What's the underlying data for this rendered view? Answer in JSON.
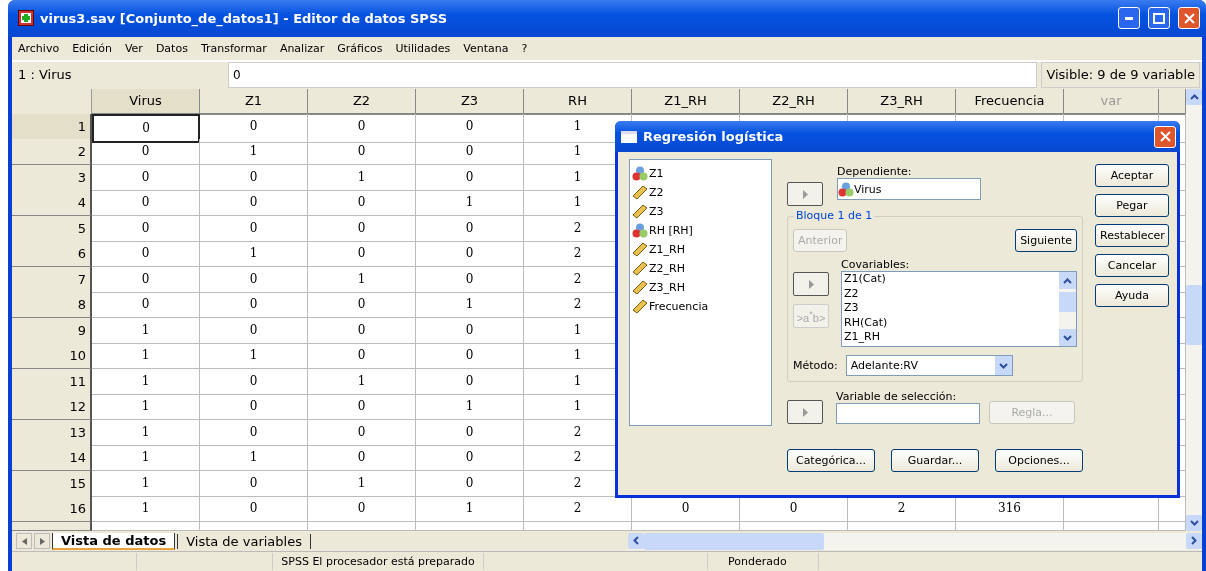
{
  "window": {
    "title": "virus3.sav [Conjunto_de_datos1] - Editor de datos SPSS"
  },
  "menu": [
    "Archivo",
    "Edición",
    "Ver",
    "Datos",
    "Transformar",
    "Analizar",
    "Gráficos",
    "Utilidades",
    "Ventana",
    "?"
  ],
  "cell_editor": {
    "cell": "1 : Virus",
    "value": "0",
    "visible": "Visible: 9 de 9 variable"
  },
  "grid": {
    "columns": [
      {
        "label": "Virus",
        "kind": "variable",
        "selected": true
      },
      {
        "label": "Z1",
        "kind": "variable",
        "selected": false
      },
      {
        "label": "Z2",
        "kind": "variable",
        "selected": false
      },
      {
        "label": "Z3",
        "kind": "variable",
        "selected": false
      },
      {
        "label": "RH",
        "kind": "variable",
        "selected": false
      },
      {
        "label": "Z1_RH",
        "kind": "variable",
        "selected": false
      },
      {
        "label": "Z2_RH",
        "kind": "variable",
        "selected": false
      },
      {
        "label": "Z3_RH",
        "kind": "variable",
        "selected": false
      },
      {
        "label": "Frecuencia",
        "kind": "variable",
        "selected": false
      },
      {
        "label": "var",
        "kind": "empty",
        "selected": false
      }
    ],
    "rows": [
      {
        "label": "1",
        "selected": true,
        "cells": [
          "0",
          "0",
          "0",
          "0",
          "1"
        ]
      },
      {
        "label": "2",
        "selected": false,
        "cells": [
          "0",
          "1",
          "0",
          "0",
          "1"
        ]
      },
      {
        "label": "3",
        "selected": false,
        "cells": [
          "0",
          "0",
          "1",
          "0",
          "1"
        ]
      },
      {
        "label": "4",
        "selected": false,
        "cells": [
          "0",
          "0",
          "0",
          "1",
          "1"
        ]
      },
      {
        "label": "5",
        "selected": false,
        "cells": [
          "0",
          "0",
          "0",
          "0",
          "2"
        ]
      },
      {
        "label": "6",
        "selected": false,
        "cells": [
          "0",
          "1",
          "0",
          "0",
          "2"
        ]
      },
      {
        "label": "7",
        "selected": false,
        "cells": [
          "0",
          "0",
          "1",
          "0",
          "2"
        ]
      },
      {
        "label": "8",
        "selected": false,
        "cells": [
          "0",
          "0",
          "0",
          "1",
          "2"
        ]
      },
      {
        "label": "9",
        "selected": false,
        "cells": [
          "1",
          "0",
          "0",
          "0",
          "1"
        ]
      },
      {
        "label": "10",
        "selected": false,
        "cells": [
          "1",
          "1",
          "0",
          "0",
          "1"
        ]
      },
      {
        "label": "11",
        "selected": false,
        "cells": [
          "1",
          "0",
          "1",
          "0",
          "1"
        ]
      },
      {
        "label": "12",
        "selected": false,
        "cells": [
          "1",
          "0",
          "0",
          "1",
          "1"
        ]
      },
      {
        "label": "13",
        "selected": false,
        "cells": [
          "1",
          "0",
          "0",
          "0",
          "2"
        ]
      },
      {
        "label": "14",
        "selected": false,
        "cells": [
          "1",
          "1",
          "0",
          "0",
          "2"
        ]
      },
      {
        "label": "15",
        "selected": false,
        "cells": [
          "1",
          "0",
          "1",
          "0",
          "2"
        ]
      },
      {
        "label": "16",
        "selected": false,
        "cells": [
          "1",
          "0",
          "0",
          "1",
          "2",
          "0",
          "0",
          "2",
          "316"
        ]
      }
    ]
  },
  "sheet_tabs": [
    {
      "label": "Vista de datos",
      "selected": true
    },
    {
      "label": "Vista de variables",
      "selected": false
    }
  ],
  "status_bar": {
    "message": "SPSS El procesador  está preparado",
    "weight": "Ponderado"
  },
  "dialog": {
    "title": "Regresión logística",
    "variables": [
      {
        "label": "Z1",
        "kind": "nominal"
      },
      {
        "label": "Z2",
        "kind": "scale"
      },
      {
        "label": "Z3",
        "kind": "scale"
      },
      {
        "label": "RH [RH]",
        "kind": "nominal"
      },
      {
        "label": "Z1_RH",
        "kind": "scale"
      },
      {
        "label": "Z2_RH",
        "kind": "scale"
      },
      {
        "label": "Z3_RH",
        "kind": "scale"
      },
      {
        "label": "Frecuencia",
        "kind": "scale"
      }
    ],
    "dependent": {
      "label": "Dependiente:",
      "value": "Virus",
      "kind": "nominal"
    },
    "block": {
      "title": "Bloque 1 de 1",
      "previous": {
        "label": "Anterior",
        "disabled": true
      },
      "next": {
        "label": "Siguiente",
        "disabled": false
      },
      "covariates_label": "Covariables:",
      "covariates": [
        "Z1(Cat)",
        "Z2",
        "Z3",
        "RH(Cat)",
        "Z1_RH"
      ],
      "interaction": {
        "label": ">a$^{*}$b>",
        "disabled": true
      },
      "method_label": "Método:",
      "method": "Adelante:RV"
    },
    "selection": {
      "label": "Variable de selección:",
      "rule": {
        "label": "Regla...",
        "disabled": true
      }
    },
    "bottom_buttons": [
      "Categórica...",
      "Guardar...",
      "Opciones..."
    ],
    "side_buttons": [
      "Aceptar",
      "Pegar",
      "Restablecer",
      "Cancelar",
      "Ayuda"
    ]
  }
}
